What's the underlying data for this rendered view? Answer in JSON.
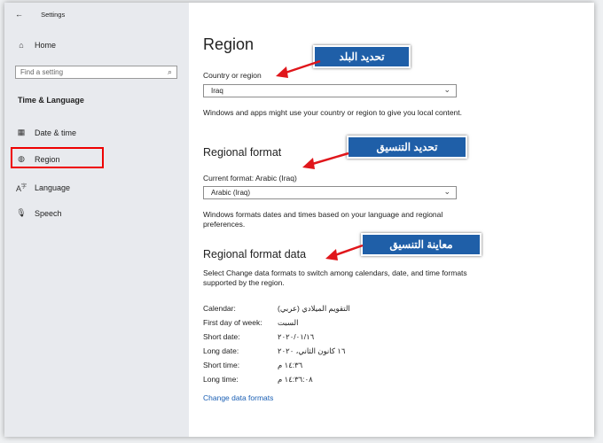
{
  "window": {
    "title": "Settings",
    "back_glyph": "←"
  },
  "sidebar": {
    "home_label": "Home",
    "search_placeholder": "Find a setting",
    "section_title": "Time & Language",
    "items": [
      {
        "label": "Date & time",
        "icon": "calendar-icon"
      },
      {
        "label": "Region",
        "icon": "globe-icon"
      },
      {
        "label": "Language",
        "icon": "language-icon"
      },
      {
        "label": "Speech",
        "icon": "microphone-icon"
      }
    ]
  },
  "main": {
    "title": "Region",
    "country_label": "Country or region",
    "country_value": "Iraq",
    "country_desc": "Windows and apps might use your country or region to give you local content.",
    "format_heading": "Regional format",
    "current_format_label": "Current format: Arabic (Iraq)",
    "format_value": "Arabic (Iraq)",
    "format_desc": "Windows formats dates and times based on your language and regional preferences.",
    "data_heading": "Regional format data",
    "data_desc": "Select Change data formats to switch among calendars, date, and time formats supported by the region.",
    "rows": [
      {
        "label": "Calendar:",
        "value": "التقويم الميلادي (عربي)"
      },
      {
        "label": "First day of week:",
        "value": "السبت"
      },
      {
        "label": "Short date:",
        "value": "٢٠٢٠/٠١/١٦"
      },
      {
        "label": "Long date:",
        "value": "١٦ كانون الثاني، ٢٠٢٠"
      },
      {
        "label": "Short time:",
        "value": "١٤:٣٦ م"
      },
      {
        "label": "Long time:",
        "value": "١٤:٣٦:٠٨ م"
      }
    ],
    "change_link": "Change data formats"
  },
  "annotations": {
    "callout_country": "تحديد البلد",
    "callout_format": "تحديد التنسيق",
    "callout_preview": "معاينة التنسيق",
    "callout_color": "#1f5fa8",
    "arrow_color": "#e0161b"
  }
}
